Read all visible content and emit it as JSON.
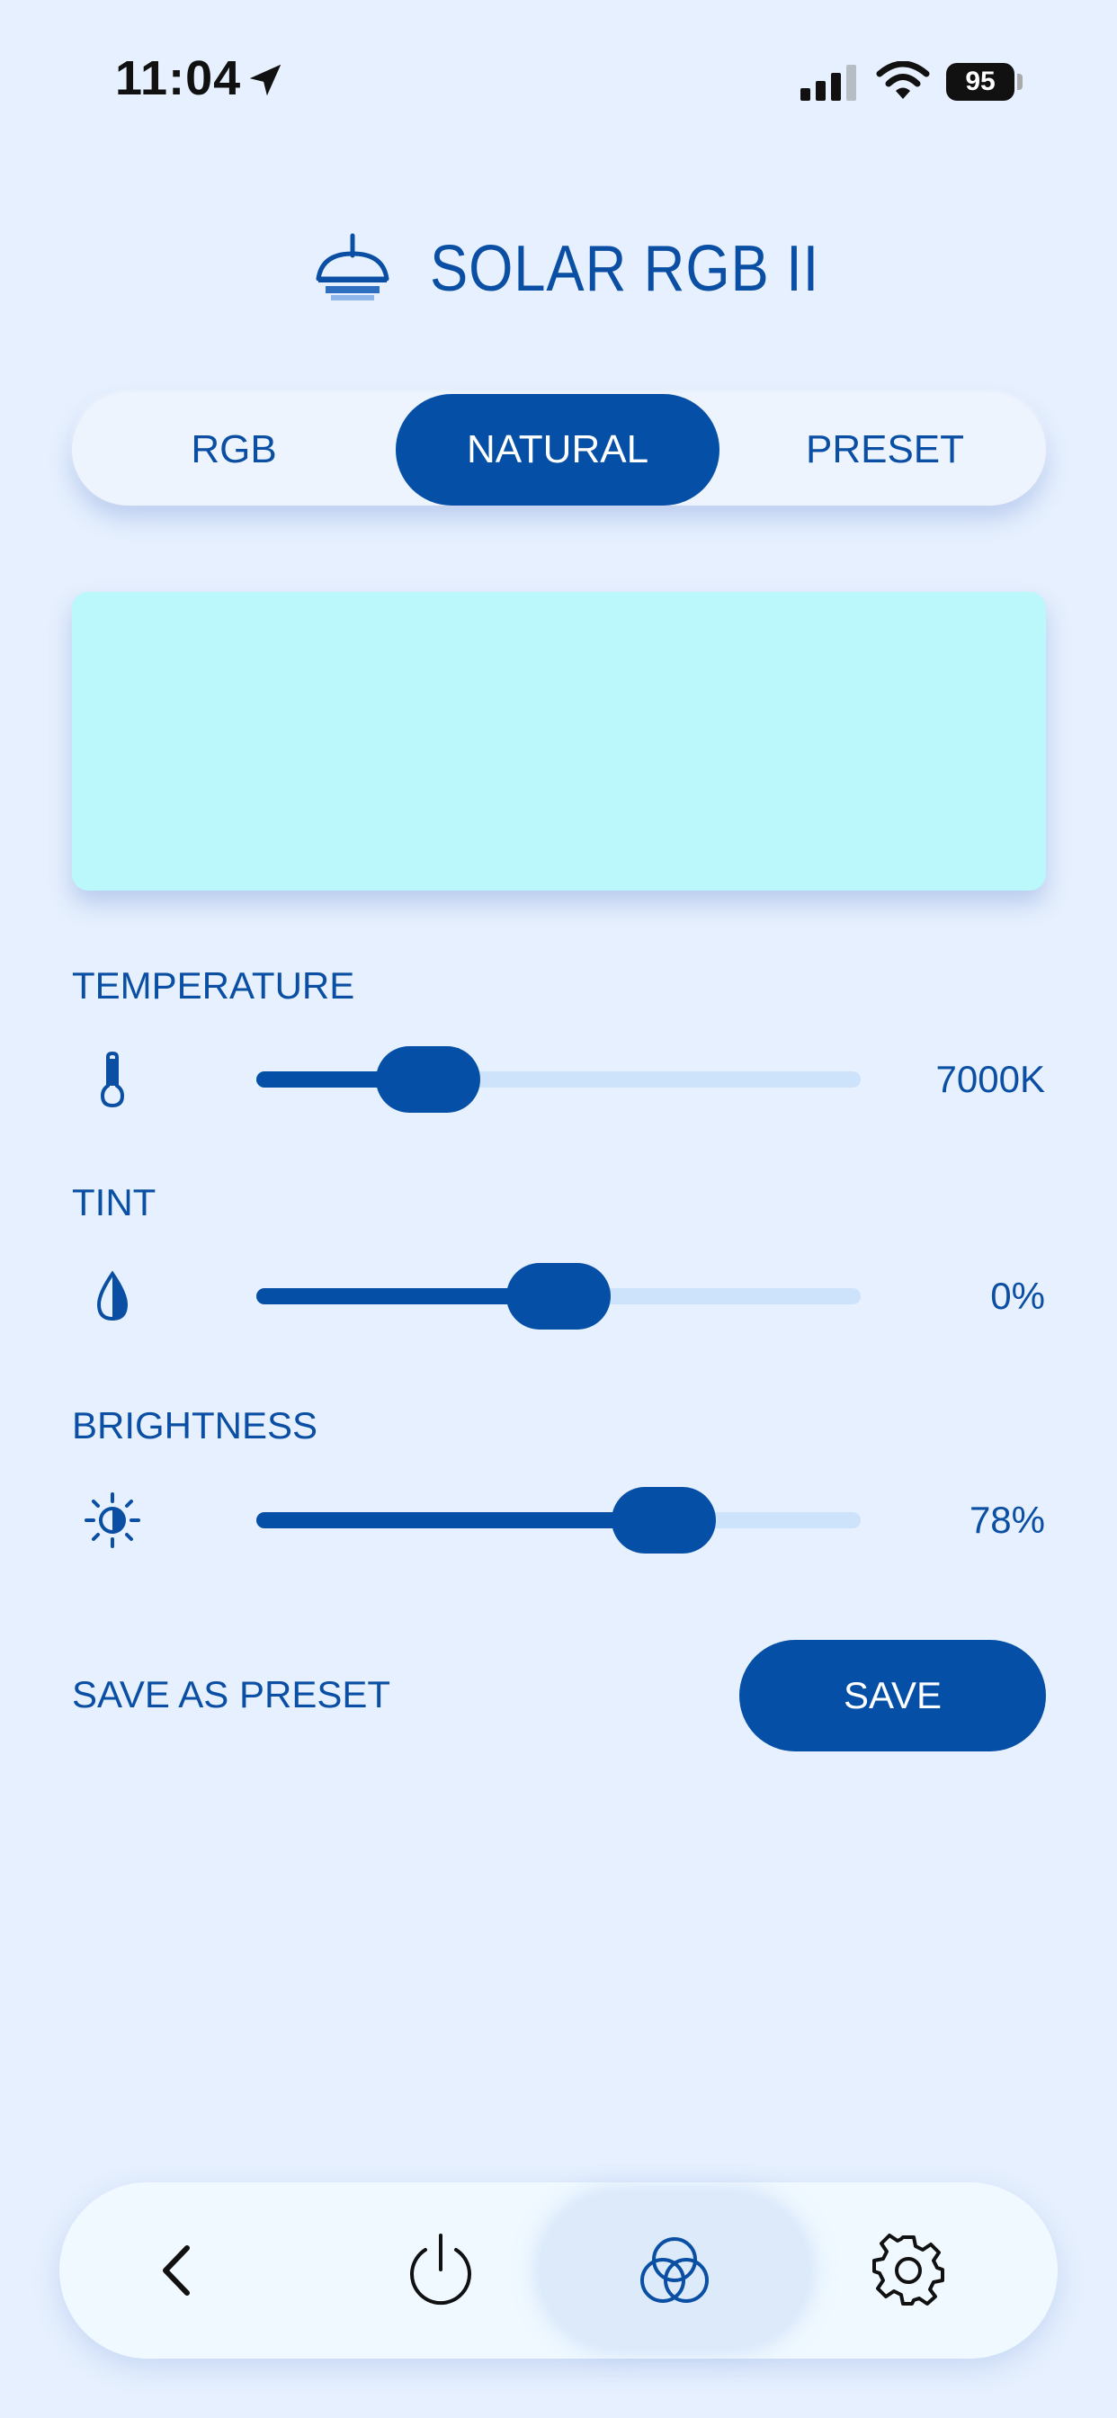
{
  "status_bar": {
    "time": "11:04",
    "battery": "95",
    "icons": [
      "location-arrow-icon",
      "cellular-signal-icon",
      "wifi-icon",
      "battery-icon"
    ]
  },
  "header": {
    "title": "SOLAR RGB II",
    "icon": "lamp-icon"
  },
  "mode_tabs": {
    "tabs": [
      {
        "label": "RGB",
        "selected": false
      },
      {
        "label": "NATURAL",
        "selected": true
      },
      {
        "label": "PRESET",
        "selected": false
      }
    ]
  },
  "preview": {
    "color": "#bbf8fb"
  },
  "sliders": {
    "temperature": {
      "label": "TEMPERATURE",
      "value": "7000K",
      "position": 0.24,
      "icon": "thermometer-icon"
    },
    "tint": {
      "label": "TINT",
      "value": "0%",
      "position": 0.5,
      "icon": "droplet-icon"
    },
    "brightness": {
      "label": "BRIGHTNESS",
      "value": "78%",
      "position": 0.71,
      "icon": "brightness-icon"
    }
  },
  "save": {
    "label": "SAVE AS PRESET",
    "button": "SAVE"
  },
  "bottom_nav": {
    "items": [
      {
        "icon": "back-chevron-icon"
      },
      {
        "icon": "power-icon"
      },
      {
        "icon": "color-circles-icon",
        "selected": true
      },
      {
        "icon": "gear-icon"
      }
    ]
  },
  "colors": {
    "accent": "#0550a6",
    "background": "#e6f0fe",
    "track": "#cde2fb"
  }
}
